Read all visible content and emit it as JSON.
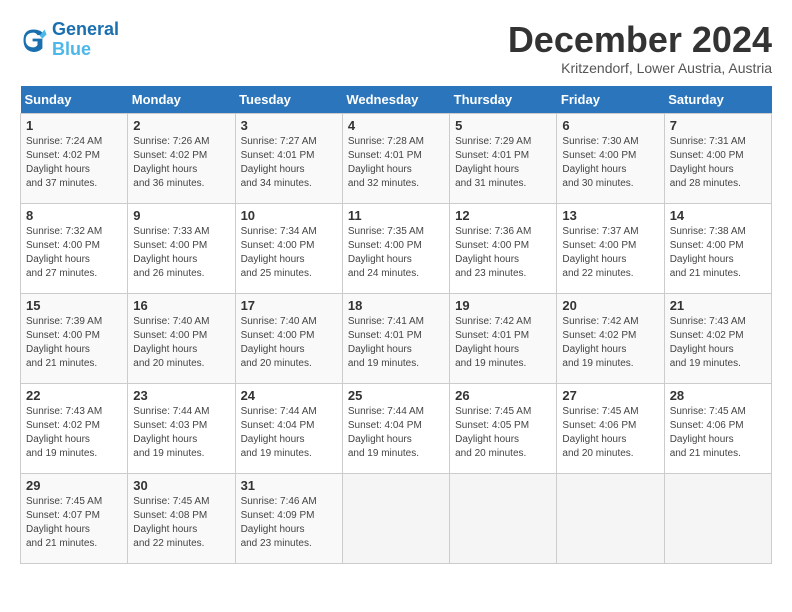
{
  "logo": {
    "line1": "General",
    "line2": "Blue"
  },
  "title": "December 2024",
  "subtitle": "Kritzendorf, Lower Austria, Austria",
  "header": {
    "days": [
      "Sunday",
      "Monday",
      "Tuesday",
      "Wednesday",
      "Thursday",
      "Friday",
      "Saturday"
    ]
  },
  "weeks": [
    [
      {
        "day": "1",
        "sunrise": "7:24 AM",
        "sunset": "4:02 PM",
        "daylight": "8 hours and 37 minutes."
      },
      {
        "day": "2",
        "sunrise": "7:26 AM",
        "sunset": "4:02 PM",
        "daylight": "8 hours and 36 minutes."
      },
      {
        "day": "3",
        "sunrise": "7:27 AM",
        "sunset": "4:01 PM",
        "daylight": "8 hours and 34 minutes."
      },
      {
        "day": "4",
        "sunrise": "7:28 AM",
        "sunset": "4:01 PM",
        "daylight": "8 hours and 32 minutes."
      },
      {
        "day": "5",
        "sunrise": "7:29 AM",
        "sunset": "4:01 PM",
        "daylight": "8 hours and 31 minutes."
      },
      {
        "day": "6",
        "sunrise": "7:30 AM",
        "sunset": "4:00 PM",
        "daylight": "8 hours and 30 minutes."
      },
      {
        "day": "7",
        "sunrise": "7:31 AM",
        "sunset": "4:00 PM",
        "daylight": "8 hours and 28 minutes."
      }
    ],
    [
      {
        "day": "8",
        "sunrise": "7:32 AM",
        "sunset": "4:00 PM",
        "daylight": "8 hours and 27 minutes."
      },
      {
        "day": "9",
        "sunrise": "7:33 AM",
        "sunset": "4:00 PM",
        "daylight": "8 hours and 26 minutes."
      },
      {
        "day": "10",
        "sunrise": "7:34 AM",
        "sunset": "4:00 PM",
        "daylight": "8 hours and 25 minutes."
      },
      {
        "day": "11",
        "sunrise": "7:35 AM",
        "sunset": "4:00 PM",
        "daylight": "8 hours and 24 minutes."
      },
      {
        "day": "12",
        "sunrise": "7:36 AM",
        "sunset": "4:00 PM",
        "daylight": "8 hours and 23 minutes."
      },
      {
        "day": "13",
        "sunrise": "7:37 AM",
        "sunset": "4:00 PM",
        "daylight": "8 hours and 22 minutes."
      },
      {
        "day": "14",
        "sunrise": "7:38 AM",
        "sunset": "4:00 PM",
        "daylight": "8 hours and 21 minutes."
      }
    ],
    [
      {
        "day": "15",
        "sunrise": "7:39 AM",
        "sunset": "4:00 PM",
        "daylight": "8 hours and 21 minutes."
      },
      {
        "day": "16",
        "sunrise": "7:40 AM",
        "sunset": "4:00 PM",
        "daylight": "8 hours and 20 minutes."
      },
      {
        "day": "17",
        "sunrise": "7:40 AM",
        "sunset": "4:00 PM",
        "daylight": "8 hours and 20 minutes."
      },
      {
        "day": "18",
        "sunrise": "7:41 AM",
        "sunset": "4:01 PM",
        "daylight": "8 hours and 19 minutes."
      },
      {
        "day": "19",
        "sunrise": "7:42 AM",
        "sunset": "4:01 PM",
        "daylight": "8 hours and 19 minutes."
      },
      {
        "day": "20",
        "sunrise": "7:42 AM",
        "sunset": "4:02 PM",
        "daylight": "8 hours and 19 minutes."
      },
      {
        "day": "21",
        "sunrise": "7:43 AM",
        "sunset": "4:02 PM",
        "daylight": "8 hours and 19 minutes."
      }
    ],
    [
      {
        "day": "22",
        "sunrise": "7:43 AM",
        "sunset": "4:02 PM",
        "daylight": "8 hours and 19 minutes."
      },
      {
        "day": "23",
        "sunrise": "7:44 AM",
        "sunset": "4:03 PM",
        "daylight": "8 hours and 19 minutes."
      },
      {
        "day": "24",
        "sunrise": "7:44 AM",
        "sunset": "4:04 PM",
        "daylight": "8 hours and 19 minutes."
      },
      {
        "day": "25",
        "sunrise": "7:44 AM",
        "sunset": "4:04 PM",
        "daylight": "8 hours and 19 minutes."
      },
      {
        "day": "26",
        "sunrise": "7:45 AM",
        "sunset": "4:05 PM",
        "daylight": "8 hours and 20 minutes."
      },
      {
        "day": "27",
        "sunrise": "7:45 AM",
        "sunset": "4:06 PM",
        "daylight": "8 hours and 20 minutes."
      },
      {
        "day": "28",
        "sunrise": "7:45 AM",
        "sunset": "4:06 PM",
        "daylight": "8 hours and 21 minutes."
      }
    ],
    [
      {
        "day": "29",
        "sunrise": "7:45 AM",
        "sunset": "4:07 PM",
        "daylight": "8 hours and 21 minutes."
      },
      {
        "day": "30",
        "sunrise": "7:45 AM",
        "sunset": "4:08 PM",
        "daylight": "8 hours and 22 minutes."
      },
      {
        "day": "31",
        "sunrise": "7:46 AM",
        "sunset": "4:09 PM",
        "daylight": "8 hours and 23 minutes."
      },
      null,
      null,
      null,
      null
    ]
  ]
}
